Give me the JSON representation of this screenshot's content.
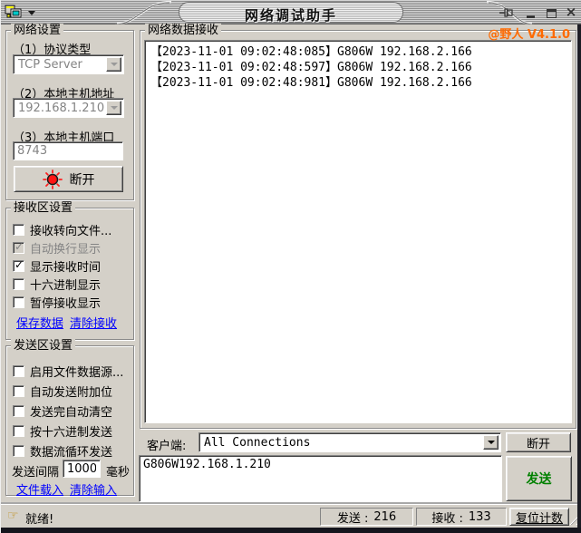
{
  "window": {
    "title": "网络调试助手"
  },
  "network_settings": {
    "title": "网络设置",
    "protocol_label": "（1）协议类型",
    "protocol_value": "TCP Server",
    "host_label": "（2）本地主机地址",
    "host_value": "192.168.1.210",
    "port_label": "（3）本地主机端口",
    "port_value": "8743",
    "disconnect_label": "断开"
  },
  "receive_settings": {
    "title": "接收区设置",
    "options": [
      {
        "label": "接收转向文件...",
        "checked": false,
        "disabled": false
      },
      {
        "label": "自动换行显示",
        "checked": true,
        "disabled": true
      },
      {
        "label": "显示接收时间",
        "checked": true,
        "disabled": false
      },
      {
        "label": "十六进制显示",
        "checked": false,
        "disabled": false
      },
      {
        "label": "暂停接收显示",
        "checked": false,
        "disabled": false
      }
    ],
    "save_link": "保存数据",
    "clear_link": "清除接收"
  },
  "send_settings": {
    "title": "发送区设置",
    "options": [
      {
        "label": "启用文件数据源...",
        "checked": false
      },
      {
        "label": "自动发送附加位",
        "checked": false
      },
      {
        "label": "发送完自动清空",
        "checked": false
      },
      {
        "label": "按十六进制发送",
        "checked": false
      },
      {
        "label": "数据流循环发送",
        "checked": false
      }
    ],
    "interval_label": "发送间隔",
    "interval_value": "1000",
    "interval_unit": "毫秒",
    "load_link": "文件载入",
    "clear_link": "清除输入"
  },
  "receive_area": {
    "title": "网络数据接收",
    "version": "@野人 V4.1.0",
    "log_lines": [
      "【2023-11-01 09:02:48:085】G806W 192.168.2.166",
      "【2023-11-01 09:02:48:597】G806W 192.168.2.166",
      "【2023-11-01 09:02:48:981】G806W 192.168.2.166"
    ]
  },
  "client_row": {
    "label": "客户端:",
    "value": "All Connections",
    "disconnect_label": "断开"
  },
  "send_area": {
    "text": "G806W192.168.1.210",
    "send_label": "发送"
  },
  "status_bar": {
    "status": "就绪!",
    "sent_label": "发送 :",
    "sent_value": "216",
    "recv_label": "接收 :",
    "recv_value": "133",
    "reset_label": "复位计数"
  },
  "colors": {
    "accent_orange": "#ff6a00",
    "link_blue": "#0000ff",
    "send_green": "#008000",
    "led_red": "#ff1414",
    "face_gray": "#d4d0c8"
  }
}
